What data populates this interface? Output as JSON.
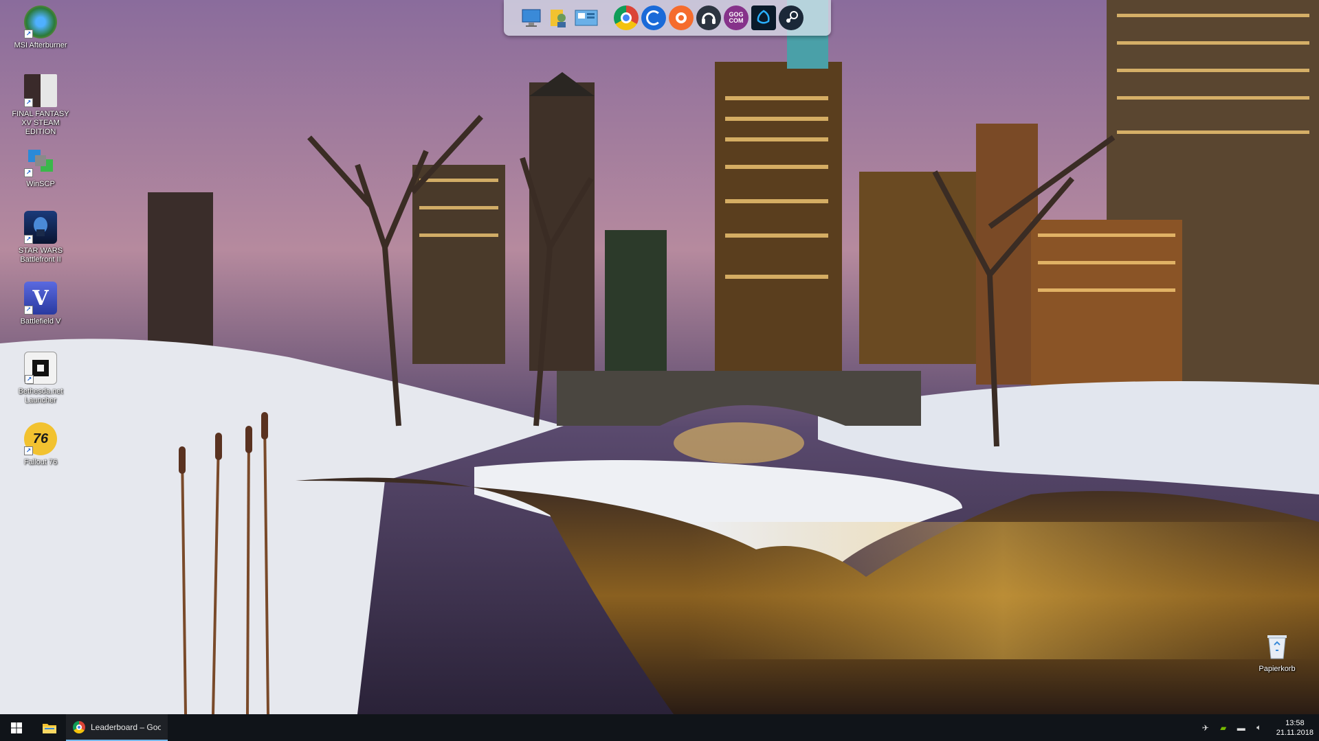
{
  "desktop": {
    "icons": [
      {
        "label": "MSI Afterburner",
        "icon": "afterburner-icon"
      },
      {
        "label": "FINAL FANTASY XV STEAM EDITION",
        "icon": "final-fantasy-icon"
      },
      {
        "label": "WinSCP",
        "icon": "winscp-icon"
      },
      {
        "label": "STAR WARS Battlefront II",
        "icon": "battlefront-icon"
      },
      {
        "label": "Battlefield V",
        "icon": "battlefield-icon"
      },
      {
        "label": "Bethesda.net Launcher",
        "icon": "bethesda-icon"
      },
      {
        "label": "Fallout 76",
        "icon": "fallout76-icon",
        "glyph_text": "76"
      }
    ],
    "recycle_bin": {
      "label": "Papierkorb",
      "icon": "recycle-bin-icon"
    }
  },
  "dock": {
    "items": [
      {
        "name": "this-pc-icon"
      },
      {
        "name": "user-folder-icon"
      },
      {
        "name": "control-panel-icon"
      },
      {
        "name": "chrome-icon"
      },
      {
        "name": "uplay-icon"
      },
      {
        "name": "origin-icon"
      },
      {
        "name": "discord-headset-icon"
      },
      {
        "name": "gog-galaxy-icon",
        "text": "GOG COM"
      },
      {
        "name": "battlenet-icon"
      },
      {
        "name": "steam-icon"
      }
    ]
  },
  "taskbar": {
    "running_app_title": "Leaderboard – Goo...",
    "clock_time": "13:58",
    "clock_date": "21.11.2018"
  },
  "colors": {
    "taskbar_bg": "#101419",
    "accent": "#76b9ed",
    "dock_bg": "#e1e6f0"
  }
}
